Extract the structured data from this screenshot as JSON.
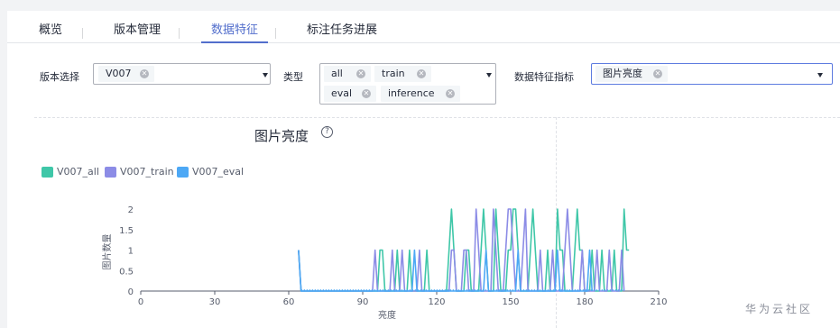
{
  "tabs": [
    {
      "label": "概览"
    },
    {
      "label": "版本管理"
    },
    {
      "label": "数据特征"
    },
    {
      "label": "标注任务进展"
    }
  ],
  "active_tab": "数据特征",
  "filters": {
    "version": {
      "label": "版本选择",
      "tags": [
        "V007"
      ]
    },
    "type": {
      "label": "类型",
      "tags": [
        "all",
        "train",
        "eval",
        "inference"
      ]
    },
    "metric": {
      "label": "数据特征指标",
      "tags": [
        "图片亮度"
      ]
    }
  },
  "chart_data": {
    "type": "line",
    "title": "图片亮度",
    "xlabel": "亮度",
    "ylabel": "图片数量",
    "xlim": [
      0,
      210
    ],
    "ylim": [
      0,
      2
    ],
    "xticks": [
      0,
      30,
      60,
      90,
      120,
      150,
      180,
      210
    ],
    "yticks": [
      0,
      0.5,
      1,
      1.5,
      2
    ],
    "legend_position": "top-left",
    "series": [
      {
        "name": "V007_all",
        "color": "#3fc7a8",
        "points": [
          [
            64,
            1
          ],
          [
            65,
            0
          ],
          [
            96,
            0
          ],
          [
            97,
            1
          ],
          [
            98,
            1
          ],
          [
            99,
            0
          ],
          [
            103,
            0
          ],
          [
            104,
            1
          ],
          [
            105,
            0
          ],
          [
            108,
            0
          ],
          [
            109,
            1
          ],
          [
            110,
            0
          ],
          [
            115,
            0
          ],
          [
            116,
            1
          ],
          [
            117,
            0
          ],
          [
            124,
            0
          ],
          [
            125,
            1
          ],
          [
            126,
            2
          ],
          [
            127,
            1
          ],
          [
            128,
            0
          ],
          [
            131,
            0
          ],
          [
            132,
            1
          ],
          [
            133,
            1
          ],
          [
            134,
            0
          ],
          [
            137,
            0
          ],
          [
            138,
            1
          ],
          [
            139,
            2
          ],
          [
            140,
            1
          ],
          [
            141,
            0
          ],
          [
            143,
            0
          ],
          [
            144,
            2
          ],
          [
            145,
            1
          ],
          [
            146,
            0
          ],
          [
            148,
            0
          ],
          [
            149,
            1
          ],
          [
            150,
            1
          ],
          [
            151,
            2
          ],
          [
            152,
            2
          ],
          [
            153,
            1
          ],
          [
            154,
            0
          ],
          [
            157,
            0
          ],
          [
            158,
            1
          ],
          [
            159,
            2
          ],
          [
            160,
            1
          ],
          [
            161,
            0
          ],
          [
            164,
            0
          ],
          [
            165,
            1
          ],
          [
            166,
            0
          ],
          [
            168,
            0
          ],
          [
            169,
            2
          ],
          [
            170,
            1
          ],
          [
            171,
            1
          ],
          [
            172,
            0
          ],
          [
            175,
            0
          ],
          [
            176,
            1
          ],
          [
            177,
            2
          ],
          [
            178,
            1
          ],
          [
            179,
            1
          ],
          [
            180,
            0
          ],
          [
            182,
            0
          ],
          [
            183,
            1
          ],
          [
            184,
            0
          ],
          [
            186,
            0
          ],
          [
            187,
            1
          ],
          [
            188,
            0
          ],
          [
            191,
            0
          ],
          [
            192,
            1
          ],
          [
            193,
            0
          ],
          [
            195,
            0
          ],
          [
            196,
            2
          ],
          [
            197,
            1
          ],
          [
            198,
            1
          ]
        ]
      },
      {
        "name": "V007_train",
        "color": "#8c8ce6",
        "points": [
          [
            64,
            1
          ],
          [
            65,
            0
          ],
          [
            94,
            0
          ],
          [
            95,
            1
          ],
          [
            96,
            0
          ],
          [
            101,
            0
          ],
          [
            102,
            1
          ],
          [
            103,
            0
          ],
          [
            105,
            0
          ],
          [
            106,
            1
          ],
          [
            107,
            0
          ],
          [
            112,
            0
          ],
          [
            113,
            1
          ],
          [
            114,
            0
          ],
          [
            125,
            0
          ],
          [
            126,
            1
          ],
          [
            127,
            1
          ],
          [
            128,
            0
          ],
          [
            130,
            0
          ],
          [
            131,
            1
          ],
          [
            132,
            1
          ],
          [
            133,
            0
          ],
          [
            135,
            0
          ],
          [
            136,
            2
          ],
          [
            137,
            1
          ],
          [
            138,
            0
          ],
          [
            142,
            0
          ],
          [
            143,
            2
          ],
          [
            144,
            1
          ],
          [
            145,
            0
          ],
          [
            147,
            0
          ],
          [
            148,
            1
          ],
          [
            149,
            2
          ],
          [
            150,
            2
          ],
          [
            151,
            1
          ],
          [
            152,
            0
          ],
          [
            154,
            0
          ],
          [
            155,
            1
          ],
          [
            156,
            2
          ],
          [
            157,
            0
          ],
          [
            161,
            0
          ],
          [
            162,
            1
          ],
          [
            163,
            0
          ],
          [
            166,
            0
          ],
          [
            167,
            1
          ],
          [
            168,
            0
          ],
          [
            171,
            0
          ],
          [
            172,
            1
          ],
          [
            173,
            2
          ],
          [
            174,
            1
          ],
          [
            175,
            0
          ],
          [
            178,
            0
          ],
          [
            179,
            1
          ],
          [
            180,
            0
          ],
          [
            184,
            0
          ],
          [
            185,
            1
          ],
          [
            186,
            0
          ],
          [
            189,
            0
          ],
          [
            190,
            1
          ],
          [
            191,
            0
          ],
          [
            194,
            0
          ],
          [
            195,
            1
          ],
          [
            196,
            0
          ]
        ]
      },
      {
        "name": "V007_eval",
        "color": "#4da8f5",
        "points": [
          [
            64,
            1
          ],
          [
            65,
            0
          ],
          [
            110,
            0
          ],
          [
            111,
            1
          ],
          [
            112,
            0
          ],
          [
            139,
            0
          ],
          [
            140,
            1
          ],
          [
            141,
            0
          ],
          [
            152,
            0
          ],
          [
            153,
            1
          ],
          [
            154,
            0
          ],
          [
            168,
            0
          ],
          [
            169,
            1
          ],
          [
            170,
            0
          ],
          [
            181,
            0
          ],
          [
            182,
            1
          ],
          [
            183,
            0
          ]
        ]
      }
    ]
  },
  "watermark": "华为云社区",
  "icons": {
    "help": "help-circle-icon",
    "tag_close": "close-circle-icon",
    "dropdown": "caret-down-icon"
  }
}
